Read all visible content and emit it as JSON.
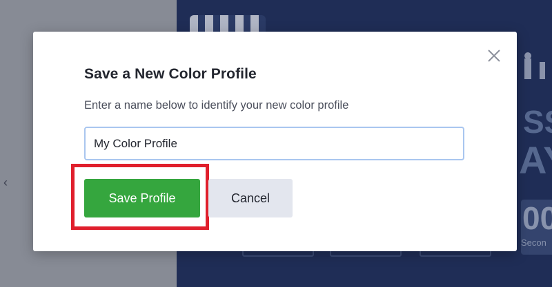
{
  "modal": {
    "title": "Save a New Color Profile",
    "description": "Enter a name below to identify your new color profile",
    "input_value": "My Color Profile",
    "save_label": "Save Profile",
    "cancel_label": "Cancel",
    "close_icon": "close-icon"
  },
  "background": {
    "partial_text_1": "SS",
    "partial_text_2": "AY",
    "seconds_number": "00",
    "seconds_label": "Secon"
  },
  "colors": {
    "save_button": "#35a63e",
    "highlight": "#e01f2c",
    "input_border": "#a9c6ef",
    "background_dark": "#1f2d56"
  }
}
